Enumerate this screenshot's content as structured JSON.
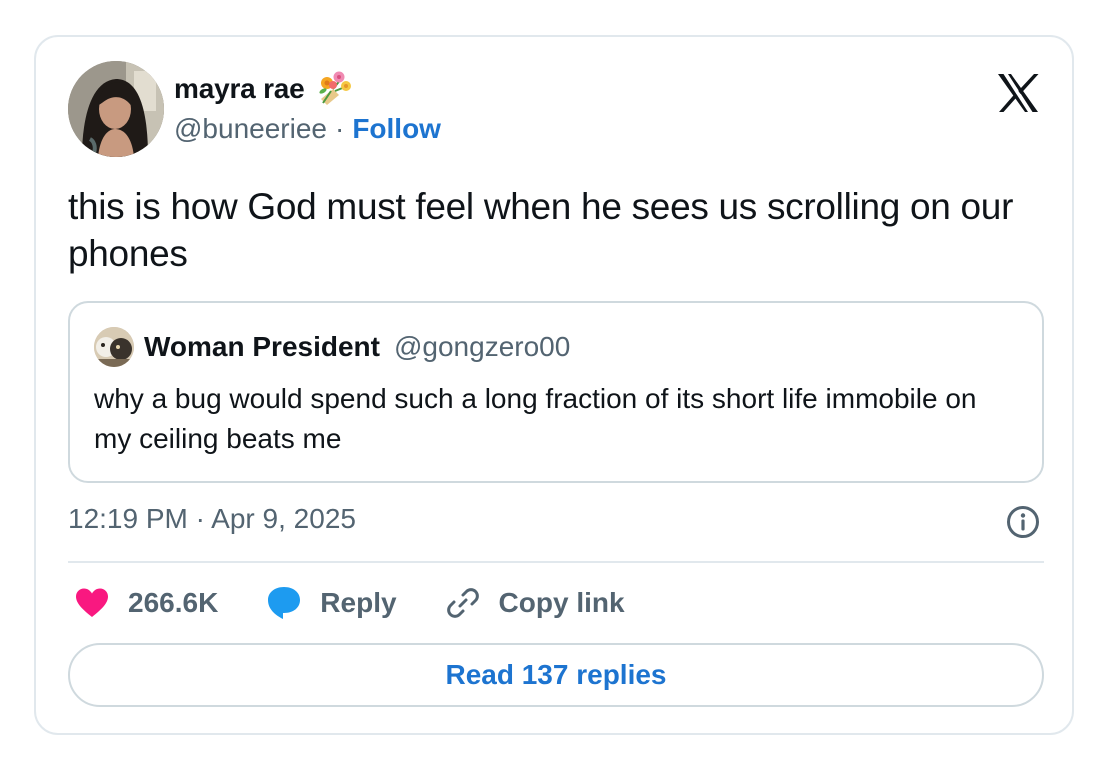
{
  "author": {
    "name": "mayra rae",
    "handle": "@buneeriee",
    "separator": "·",
    "follow_label": "Follow",
    "emoji_icon": "bouquet-icon"
  },
  "tweet": {
    "text": "this is how God must feel when he sees us scrolling on our phones",
    "timestamp": "12:19 PM · Apr 9, 2025"
  },
  "quote": {
    "name": "Woman President",
    "handle": "@gongzero00",
    "text": "why a bug would spend such a long fraction of its short life immobile on my ceiling beats me"
  },
  "actions": {
    "likes": "266.6K",
    "reply_label": "Reply",
    "copy_label": "Copy link"
  },
  "read_replies_label": "Read 137 replies",
  "colors": {
    "accent": "#1d74d0",
    "like": "#f91880",
    "reply": "#1d9bf0",
    "muted": "#536471",
    "text": "#0f1419",
    "border": "#cfd9de"
  }
}
